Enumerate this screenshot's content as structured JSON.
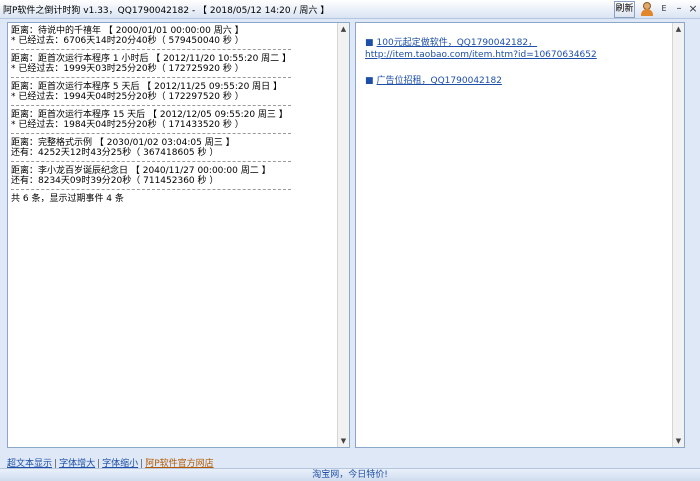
{
  "window": {
    "title": "阿P软件之倒计时狗 v1.33，QQ1790042182 - 【 2018/05/12 14:20 / 周六 】",
    "refresh_label": "刷新",
    "e_label": "E",
    "min_label": "–",
    "close_label": "×"
  },
  "events": [
    {
      "line1": "距离：待说中的千禧年 【 2000/01/01 00:00:00 周六 】",
      "line2": "* 已经过去：6706天14时20分40秒（ 579450040 秒 ）"
    },
    {
      "line1": "距离：距首次运行本程序 1 小时后 【 2012/11/20 10:55:20 周二 】",
      "line2": "* 已经过去：1999天03时25分20秒（ 172725920 秒 ）"
    },
    {
      "line1": "距离：距首次运行本程序 5 天后 【 2012/11/25 09:55:20 周日 】",
      "line2": "* 已经过去：1994天04时25分20秒（ 172297520 秒 ）"
    },
    {
      "line1": "距离：距首次运行本程序 15 天后 【 2012/12/05 09:55:20 周三 】",
      "line2": "* 已经过去：1984天04时25分20秒（ 171433520 秒 ）"
    },
    {
      "line1": "距离：完整格式示例 【 2030/01/02 03:04:05 周三 】",
      "line2": "还有：4252天12时43分25秒（ 367418605 秒 ）"
    },
    {
      "line1": "距离：李小龙百岁诞辰纪念日 【 2040/11/27 00:00:00 周二 】",
      "line2": "还有：8234天09时39分20秒（ 711452360 秒 ）"
    }
  ],
  "summary": "共 6 条，显示过期事件 4 条",
  "right": {
    "bullet": "■",
    "link1_line1": "100元起定做软件，QQ1790042182，",
    "link1_line2": "http://item.taobao.com/item.htm?id=10670634652",
    "link2": "广告位招租，QQ1790042182"
  },
  "bottom": {
    "link1": "超文本显示",
    "link2": "字体增大",
    "link3": "字体缩小",
    "link4": "阿P软件官方网店",
    "sep": "|"
  },
  "status": {
    "text": "淘宝网，今日特价!"
  },
  "scroll": {
    "up": "▲",
    "down": "▼"
  }
}
